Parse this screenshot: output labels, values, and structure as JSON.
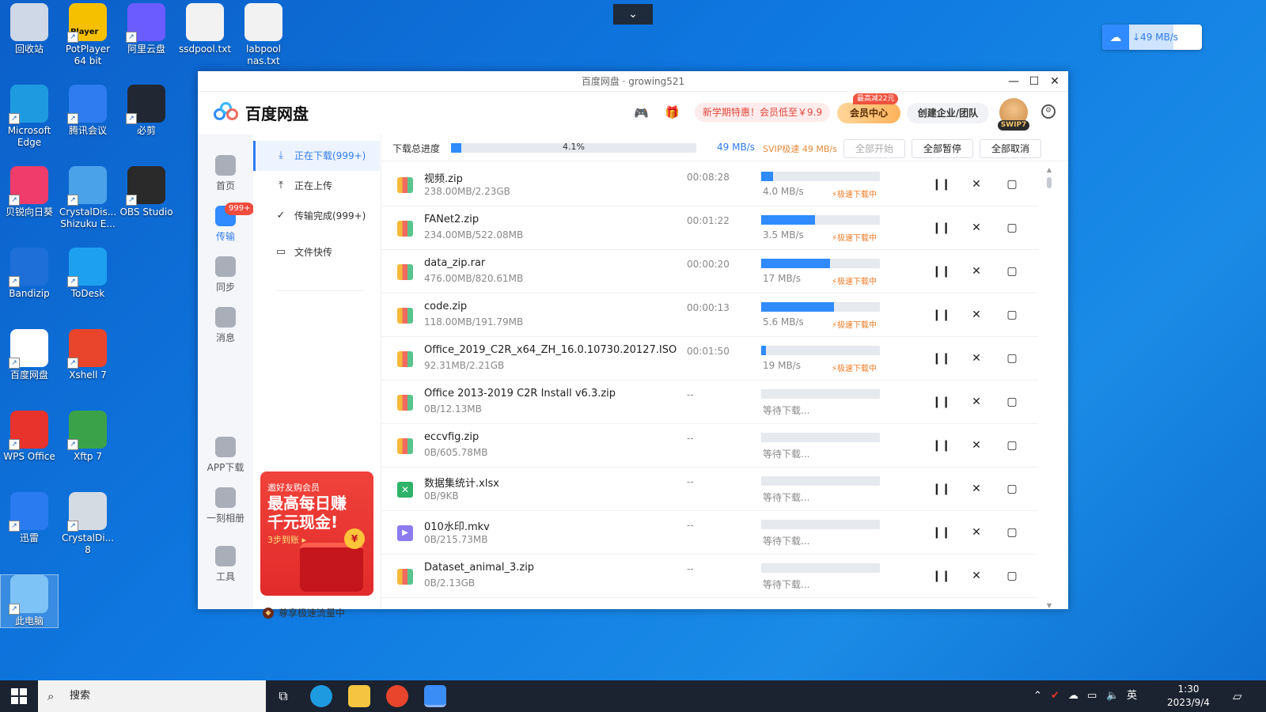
{
  "desktop": {
    "icons": [
      {
        "label": "回收站",
        "color": "#cfd8e6"
      },
      {
        "label": "PotPlayer 64 bit",
        "color": "#f5c000",
        "badge": "Player"
      },
      {
        "label": "阿里云盘",
        "color": "#6a5cff"
      },
      {
        "label": "ssdpool.txt",
        "color": "#f2f2f2"
      },
      {
        "label": "labpool nas.txt",
        "color": "#f2f2f2"
      },
      {
        "label": "Microsoft Edge",
        "color": "#1e9be0"
      },
      {
        "label": "腾讯会议",
        "color": "#2f7cf0"
      },
      {
        "label": "必剪",
        "color": "#222833"
      },
      {
        "label": "贝锐向日葵",
        "color": "#f03c6a"
      },
      {
        "label": "CrystalDis... Shizuku E...",
        "color": "#4aa3e8"
      },
      {
        "label": "OBS Studio",
        "color": "#2a2a2a"
      },
      {
        "label": "Bandizip",
        "color": "#1e6fd8"
      },
      {
        "label": "ToDesk",
        "color": "#1ea0f0"
      },
      {
        "label": "百度网盘",
        "color": "#ffffff"
      },
      {
        "label": "Xshell 7",
        "color": "#e8452c"
      },
      {
        "label": "WPS Office",
        "color": "#e8322c"
      },
      {
        "label": "Xftp 7",
        "color": "#3aa34a"
      },
      {
        "label": "迅雷",
        "color": "#2a7bf0"
      },
      {
        "label": "CrystalDi... 8",
        "color": "#d4dbe3"
      },
      {
        "label": "此电脑",
        "color": "#7dc3f5"
      }
    ]
  },
  "speed_widget": {
    "text": "↓49 MB/s"
  },
  "window": {
    "title": "百度网盘 · growing521",
    "controls": {
      "minimize": "—",
      "maximize": "☐",
      "close": "✕"
    },
    "logo_text": "百度网盘",
    "promo": "新学期特惠！会员低至￥9.9",
    "vip_badge": "最高减22元",
    "vip_label": "会员中心",
    "enterprise_label": "创建企业/团队",
    "svip": "SWIP7"
  },
  "rail": {
    "items": [
      {
        "label": "首页",
        "icon": "cloud-icon"
      },
      {
        "label": "传输",
        "icon": "transfer-icon",
        "badge": "999+"
      },
      {
        "label": "同步",
        "icon": "sync-icon"
      },
      {
        "label": "消息",
        "icon": "message-icon"
      },
      {
        "label": "APP下载",
        "icon": "app-icon"
      },
      {
        "label": "一刻相册",
        "icon": "album-icon"
      },
      {
        "label": "工具",
        "icon": "tools-icon"
      }
    ]
  },
  "sub": {
    "items": [
      {
        "label": "正在下载(999+)",
        "icon": "⤓"
      },
      {
        "label": "正在上传",
        "icon": "⤒"
      },
      {
        "label": "传输完成(999+)",
        "icon": "✓"
      },
      {
        "label": "文件快传",
        "icon": "▭"
      }
    ],
    "ad": {
      "l1": "邀好友购会员",
      "l2": "最高每日赚",
      "l3": "千元现金!",
      "l4": "3步到账 ▸",
      "coin": "¥"
    },
    "flow": "尊享极速流量中"
  },
  "toolbar": {
    "label": "下载总进度",
    "percent_text": "4.1%",
    "progress": 0.041,
    "speed": "49 MB/s",
    "svip": "SVIP极速 49 MB/s",
    "start_all": "全部开始",
    "pause_all": "全部暂停",
    "cancel_all": "全部取消"
  },
  "downloads": [
    {
      "name": "视频.zip",
      "size": "238.00MB/2.23GB",
      "time": "00:08:28",
      "progress": 0.1,
      "speed": "4.0 MB/s",
      "accel": "⚡极速下载中",
      "type": "zip"
    },
    {
      "name": "FANet2.zip",
      "size": "234.00MB/522.08MB",
      "time": "00:01:22",
      "progress": 0.45,
      "speed": "3.5 MB/s",
      "accel": "⚡极速下载中",
      "type": "zip"
    },
    {
      "name": "data_zip.rar",
      "size": "476.00MB/820.61MB",
      "time": "00:00:20",
      "progress": 0.58,
      "speed": "17 MB/s",
      "accel": "⚡极速下载中",
      "type": "zip"
    },
    {
      "name": "code.zip",
      "size": "118.00MB/191.79MB",
      "time": "00:00:13",
      "progress": 0.61,
      "speed": "5.6 MB/s",
      "accel": "⚡极速下载中",
      "type": "zip"
    },
    {
      "name": "Office_2019_C2R_x64_ZH_16.0.10730.20127.ISO",
      "size": "92.31MB/2.21GB",
      "time": "00:01:50",
      "progress": 0.04,
      "speed": "19 MB/s",
      "accel": "⚡极速下载中",
      "type": "zip"
    },
    {
      "name": "Office 2013-2019 C2R Install v6.3.zip",
      "size": "0B/12.13MB",
      "time": "--",
      "progress": 0,
      "speed": "等待下载...",
      "accel": "",
      "type": "zip"
    },
    {
      "name": "eccvfig.zip",
      "size": "0B/605.78MB",
      "time": "--",
      "progress": 0,
      "speed": "等待下载...",
      "accel": "",
      "type": "zip"
    },
    {
      "name": "数据集统计.xlsx",
      "size": "0B/9KB",
      "time": "--",
      "progress": 0,
      "speed": "等待下载...",
      "accel": "",
      "type": "xls"
    },
    {
      "name": "010水印.mkv",
      "size": "0B/215.73MB",
      "time": "--",
      "progress": 0,
      "speed": "等待下载...",
      "accel": "",
      "type": "vid"
    },
    {
      "name": "Dataset_animal_3.zip",
      "size": "0B/2.13GB",
      "time": "--",
      "progress": 0,
      "speed": "等待下载...",
      "accel": "",
      "type": "zip"
    }
  ],
  "row_actions": {
    "pause": "❙❙",
    "cancel": "✕",
    "folder": "▢"
  },
  "taskbar": {
    "search": "搜索",
    "ime": "英",
    "time": "1:30",
    "date": "2023/9/4"
  }
}
